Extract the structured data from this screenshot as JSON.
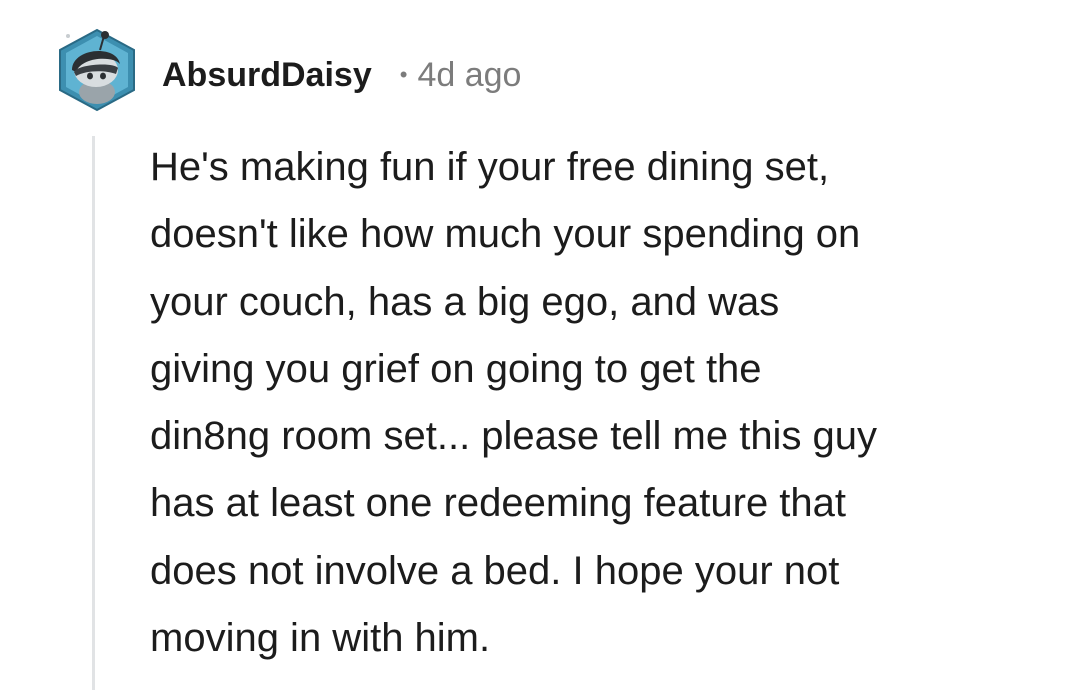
{
  "comment": {
    "author": "AbsurdDaisy",
    "separator": "•",
    "timestamp": "4d ago",
    "avatar_icon": "snoo-avatar-icon",
    "body": "He's making fun if your free dining set,\ndoesn't like how much your spending on\nyour couch, has a big ego, and was\ngiving you grief on going to get the\ndin8ng room set... please tell me this guy\nhas at least one redeeming feature that\ndoes not involve a bed. I hope your not\nmoving in with him."
  },
  "colors": {
    "text": "#1c1c1c",
    "meta": "#7c7c7c",
    "thread_line": "#e1e3e5",
    "avatar_bg": "#4a90a4"
  }
}
